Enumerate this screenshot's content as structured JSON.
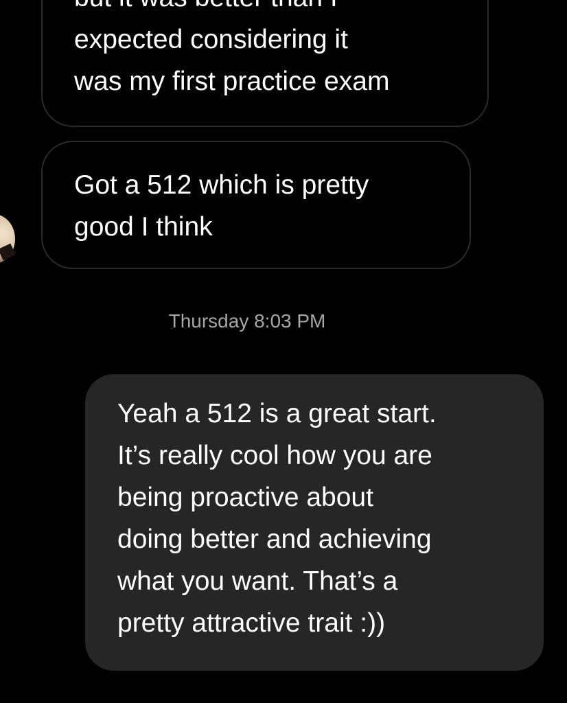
{
  "conversation": {
    "messages": [
      {
        "sender": "other",
        "lines": [
          "but it was better than I",
          "expected considering it",
          "was my first practice exam"
        ]
      },
      {
        "sender": "other",
        "lines": [
          "Got a 512 which is pretty",
          "good I think"
        ]
      },
      {
        "sender": "me",
        "lines": [
          "Yeah a 512 is a great start.",
          "It’s really cool how you are",
          "being proactive about",
          "doing better and achieving",
          "what you want. That’s a",
          "pretty attractive trait :))"
        ]
      }
    ],
    "timestamp": "Thursday 8:03 PM"
  },
  "colors": {
    "background": "#000000",
    "incoming_bubble_border": "#2b2b2b",
    "outgoing_bubble": "#262626",
    "timestamp_text": "#a6a6a6",
    "message_text": "#ffffff"
  }
}
